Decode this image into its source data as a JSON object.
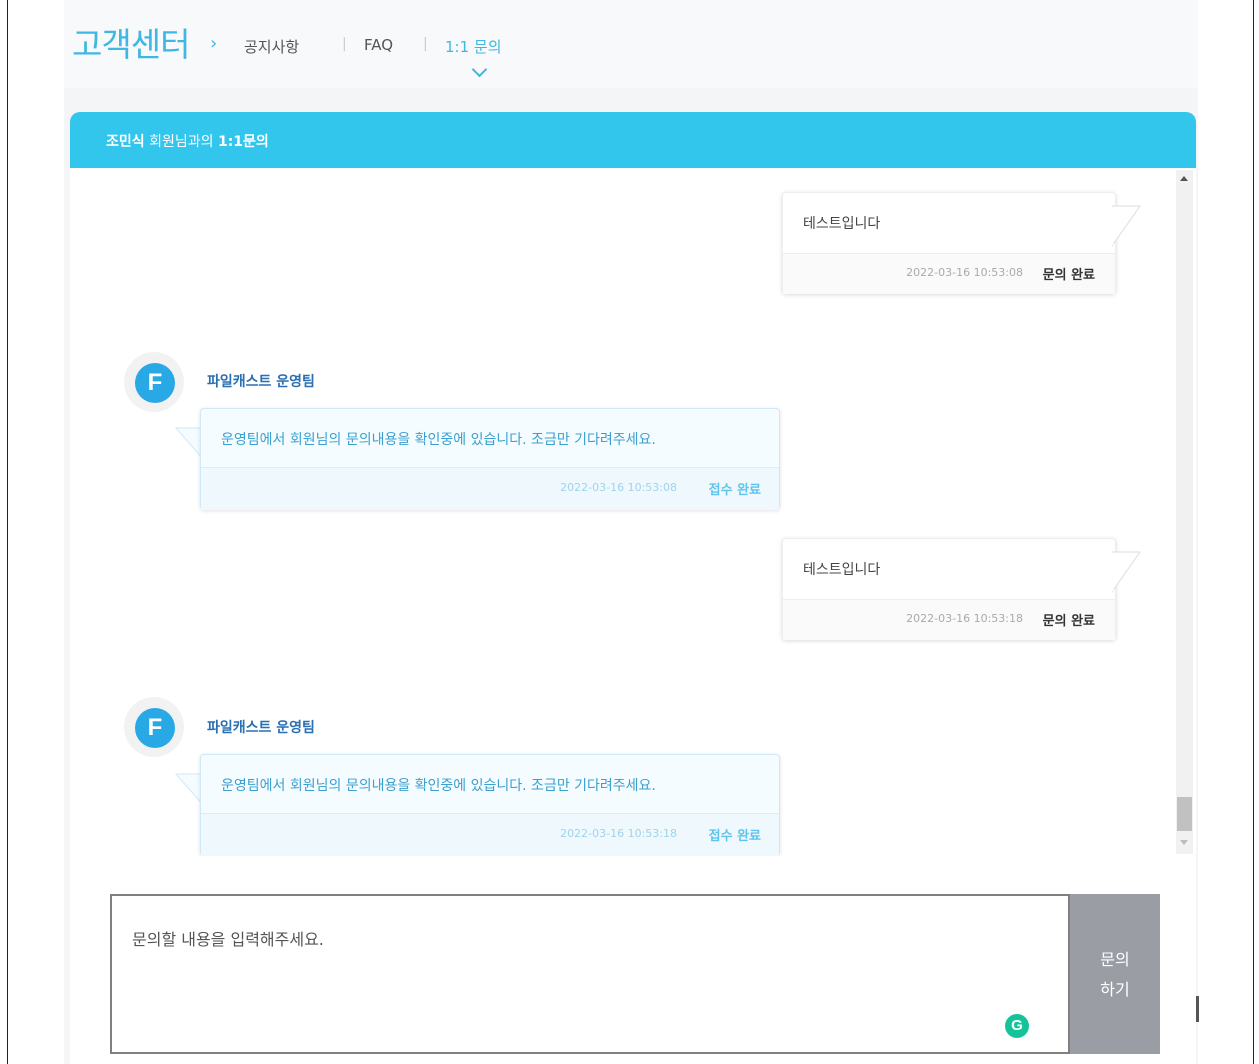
{
  "header": {
    "brand": "고객센터",
    "nav": [
      {
        "label": "공지사항",
        "active": false
      },
      {
        "label": "FAQ",
        "active": false
      },
      {
        "label": "1:1 문의",
        "active": true
      }
    ]
  },
  "chat": {
    "title_name": "조민식",
    "title_middle": " 회원님과의 ",
    "title_suffix": "1:1문의",
    "messages": [
      {
        "sender": "user",
        "text": "테스트입니다",
        "time": "2022-03-16 10:53:08",
        "status": "문의 완료"
      },
      {
        "sender": "admin",
        "team": "파일캐스트 운영팀",
        "text": "운영팀에서 회원님의 문의내용을 확인중에 있습니다. 조금만 기다려주세요.",
        "time": "2022-03-16 10:53:08",
        "status": "접수 완료"
      },
      {
        "sender": "user",
        "text": "테스트입니다",
        "time": "2022-03-16 10:53:18",
        "status": "문의 완료"
      },
      {
        "sender": "admin",
        "team": "파일캐스트 운영팀",
        "text": "운영팀에서 회원님의 문의내용을 확인중에 있습니다. 조금만 기다려주세요.",
        "time": "2022-03-16 10:53:18",
        "status": "접수 완료"
      }
    ],
    "logo_letter": "F"
  },
  "input": {
    "placeholder": "문의할 내용을 입력해주세요.",
    "grammarly_letter": "G",
    "submit_line1": "문의",
    "submit_line2": "하기"
  },
  "colors": {
    "accent": "#33c6ed",
    "brand_blue": "#3eb7e4",
    "button_gray": "#9a9ea4"
  }
}
